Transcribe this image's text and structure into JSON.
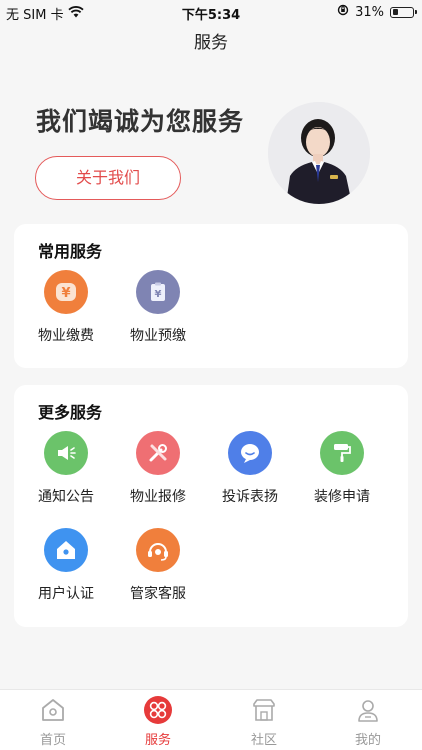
{
  "status_bar": {
    "carrier": "无 SIM 卡",
    "time": "下午5:34",
    "battery_percent": "31%",
    "battery_level": 0.31
  },
  "nav": {
    "title": "服务"
  },
  "hero": {
    "title": "我们竭诚为您服务",
    "about_button": "关于我们",
    "accent_color": "#e24b4b"
  },
  "common_services": {
    "title": "常用服务",
    "items": [
      {
        "label": "物业缴费",
        "icon": "yuan-icon",
        "color": "#f07f3c"
      },
      {
        "label": "物业预缴",
        "icon": "clipboard-icon",
        "color": "#7f84b3"
      }
    ]
  },
  "more_services": {
    "title": "更多服务",
    "items": [
      {
        "label": "通知公告",
        "icon": "megaphone-icon",
        "color": "#6bc36a"
      },
      {
        "label": "物业报修",
        "icon": "tools-icon",
        "color": "#ef6f73"
      },
      {
        "label": "投诉表扬",
        "icon": "chat-bubble-icon",
        "color": "#4f7fe8"
      },
      {
        "label": "装修申请",
        "icon": "paint-roller-icon",
        "color": "#6bc36a"
      },
      {
        "label": "用户认证",
        "icon": "home-icon",
        "color": "#3f93f0"
      },
      {
        "label": "管家客服",
        "icon": "headset-icon",
        "color": "#f07f3c"
      }
    ]
  },
  "tabbar": {
    "items": [
      {
        "label": "首页",
        "icon": "home-outline-icon",
        "active": false
      },
      {
        "label": "服务",
        "icon": "service-icon",
        "active": true
      },
      {
        "label": "社区",
        "icon": "community-icon",
        "active": false
      },
      {
        "label": "我的",
        "icon": "profile-icon",
        "active": false
      }
    ],
    "active_color": "#e63a3a"
  }
}
